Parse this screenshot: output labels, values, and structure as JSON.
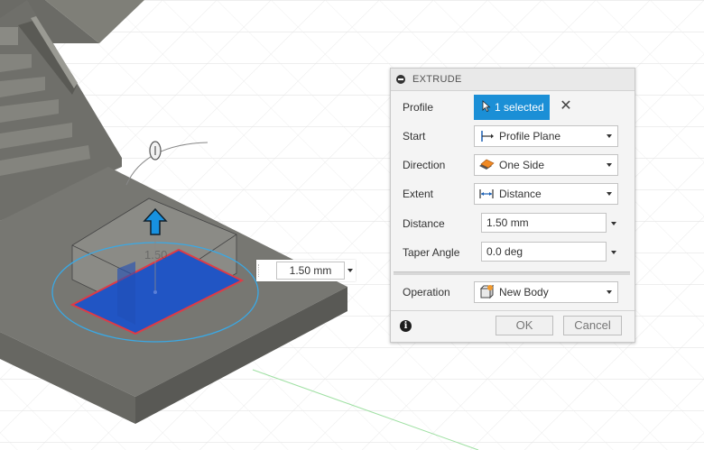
{
  "dialog": {
    "title": "EXTRUDE",
    "profile": {
      "label": "Profile",
      "selected": "1 selected"
    },
    "start": {
      "label": "Start",
      "value": "Profile Plane"
    },
    "direction": {
      "label": "Direction",
      "value": "One Side"
    },
    "extent": {
      "label": "Extent",
      "value": "Distance"
    },
    "distance": {
      "label": "Distance",
      "value": "1.50 mm"
    },
    "taper": {
      "label": "Taper Angle",
      "value": "0.0 deg"
    },
    "operation": {
      "label": "Operation",
      "value": "New Body"
    },
    "ok_label": "OK",
    "cancel_label": "Cancel"
  },
  "viewport": {
    "distance_value": "1.50 mm",
    "ghost_label": "1.50"
  },
  "colors": {
    "accent": "#1b8fd6",
    "profile_fill": "#2155c4",
    "profile_outline": "#e03a45",
    "manipulator": "#1791e0"
  },
  "icons": [
    "collapse-icon",
    "cursor-icon",
    "clear-icon",
    "profile-plane-icon",
    "one-side-icon",
    "distance-icon",
    "new-body-icon",
    "info-icon",
    "arrow-manipulator-icon",
    "chevron-down-icon"
  ]
}
